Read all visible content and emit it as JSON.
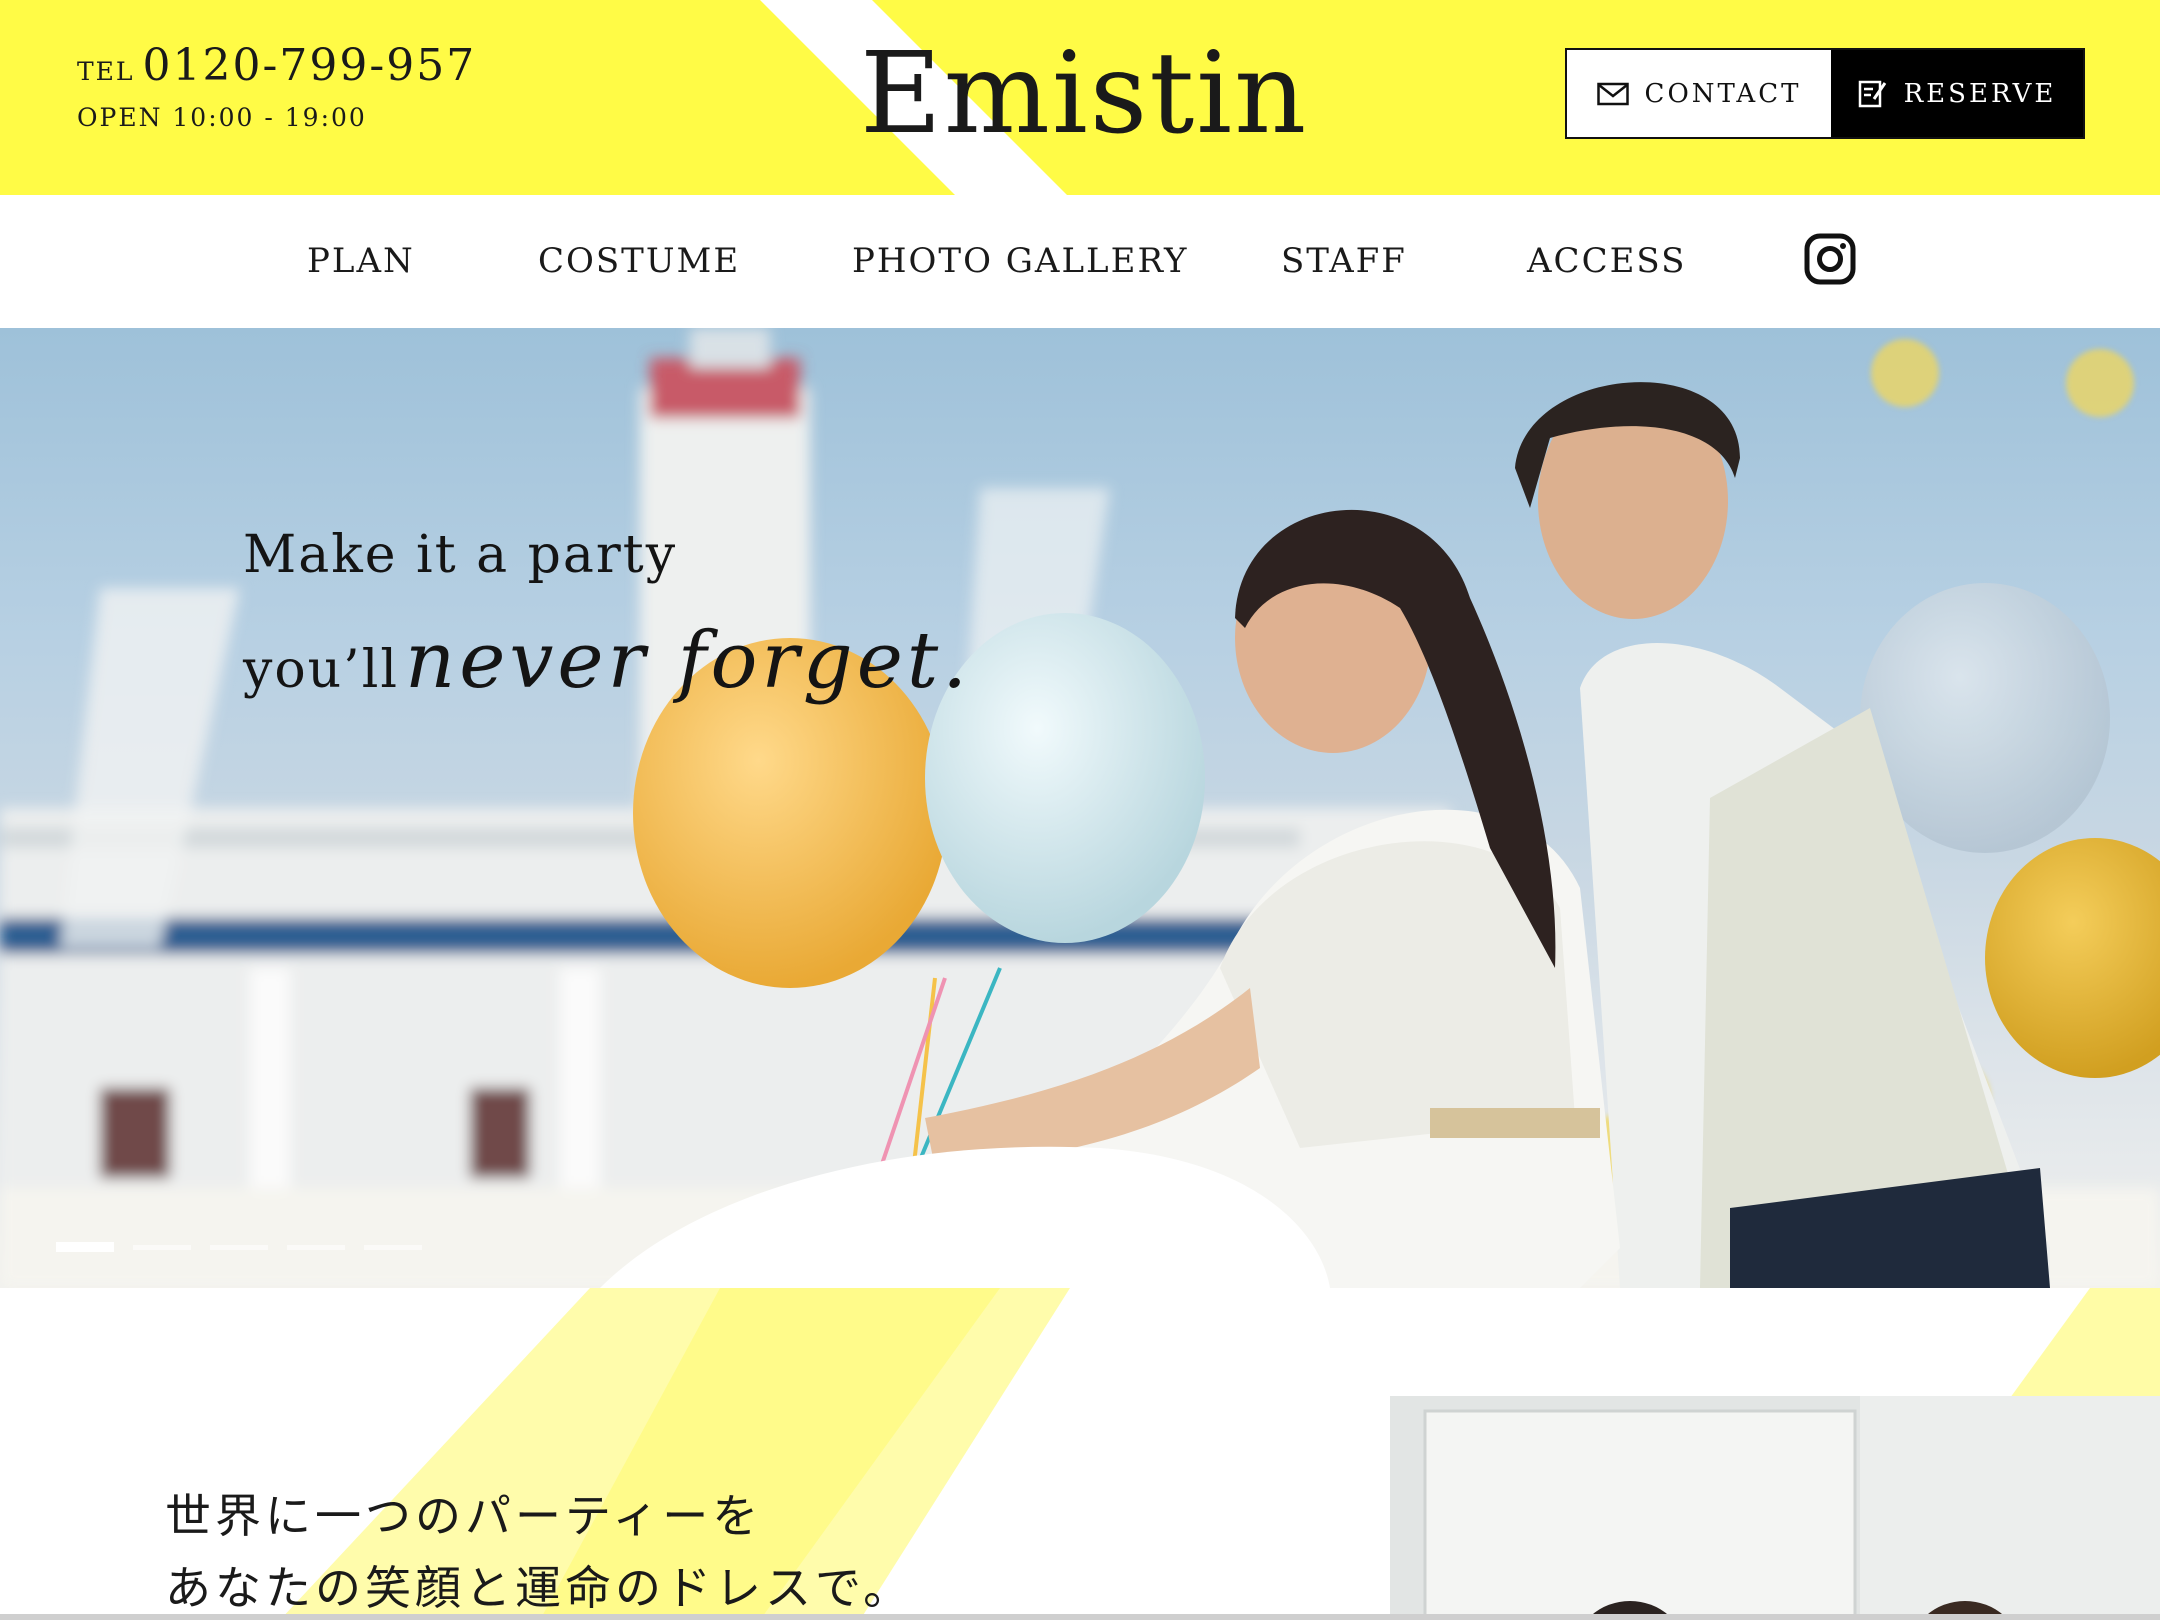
{
  "header": {
    "tel_prefix": "TEL",
    "tel_number": "0120-799-957",
    "open_hours": "OPEN 10:00 - 19:00",
    "logo": "Emistin",
    "contact_label": "CONTACT",
    "reserve_label": "RESERVE",
    "accent_color": "#fffb46"
  },
  "nav": {
    "items": [
      "PLAN",
      "COSTUME",
      "PHOTO GALLERY",
      "STAFF",
      "ACCESS"
    ],
    "social_icon": "instagram-icon"
  },
  "hero": {
    "tagline_line1": "Make it a party",
    "tagline_line2_start": "you’ll",
    "tagline_line2_script": "never forget.",
    "slide_count": 5,
    "active_slide": 1
  },
  "intro": {
    "line1": "世界に一つのパーティーを",
    "line2": "あなたの笑顔と運命のドレスで。"
  }
}
